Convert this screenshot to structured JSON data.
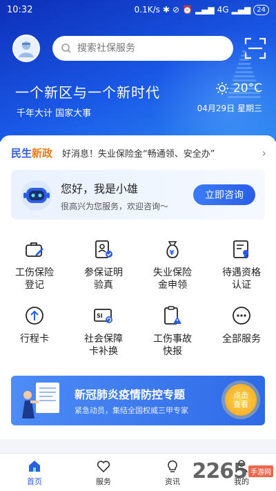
{
  "status_bar": {
    "time": "10:32",
    "net_speed": "0.1K/s",
    "network": "4G",
    "battery": "24"
  },
  "header": {
    "search_placeholder": "搜索社保服务",
    "slogan": "一个新区与一个新时代",
    "subslogan": "千年大计 国家大事",
    "temperature": "20°C",
    "date": "04月29日 星期三"
  },
  "news": {
    "tag_part1": "民生",
    "tag_part2": "新政",
    "text": "好消息！失业保险金“畅通领、安全办”"
  },
  "assistant": {
    "greeting": "您好，我是小雄",
    "sub": "很高兴为您服务，欢迎咨询～",
    "button": "立即咨询"
  },
  "services": [
    {
      "label": "工伤保险\n登记",
      "icon": "briefcase-edit-icon"
    },
    {
      "label": "参保证明\n验真",
      "icon": "id-check-icon"
    },
    {
      "label": "失业保险\n金申领",
      "icon": "money-bag-icon"
    },
    {
      "label": "待遇资格\n认证",
      "icon": "certificate-icon"
    },
    {
      "label": "行程卡",
      "icon": "arrow-up-circle-icon"
    },
    {
      "label": "社会保障\n卡补换",
      "icon": "si-card-icon"
    },
    {
      "label": "工伤事故\n快报",
      "icon": "report-warning-icon"
    },
    {
      "label": "全部服务",
      "icon": "more-dots-icon"
    }
  ],
  "banner": {
    "title": "新冠肺炎疫情防控专题",
    "sub": "紧急动员，集结全国权威三甲专家",
    "button": "点击\n查看"
  },
  "tabs": [
    {
      "label": "首页",
      "icon": "home-icon",
      "active": true
    },
    {
      "label": "服务",
      "icon": "heart-icon",
      "active": false
    },
    {
      "label": "资讯",
      "icon": "bulb-icon",
      "active": false
    },
    {
      "label": "我的",
      "icon": "person-icon",
      "active": false
    }
  ],
  "watermark": {
    "number": "2265",
    "text": "手游网"
  },
  "colors": {
    "primary": "#2a5de8",
    "accent": "#f07a1a",
    "hero_dark": "#0d2fb8"
  }
}
